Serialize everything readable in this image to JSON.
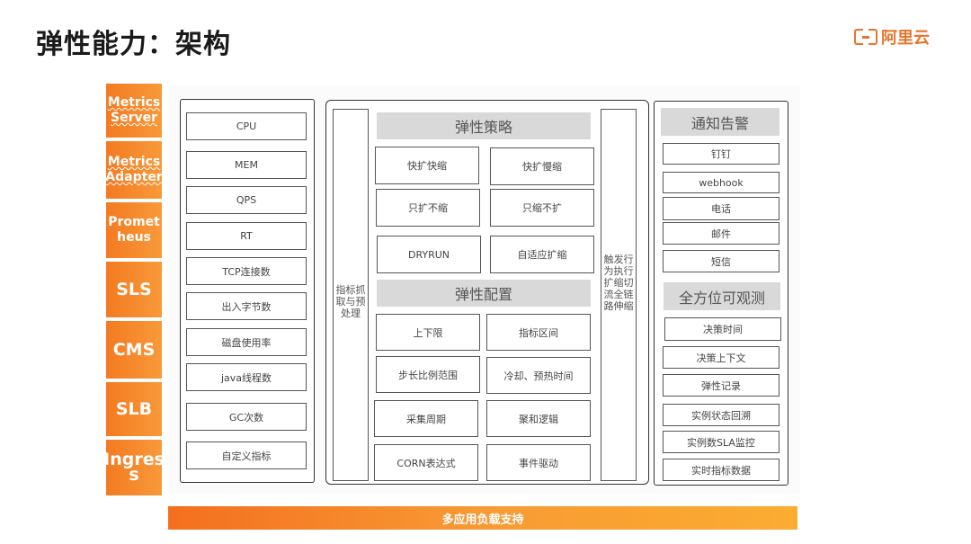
{
  "header": {
    "title": "弹性能力：架构",
    "logo_text": "阿里云",
    "brand_color": "#e8742c"
  },
  "sources": [
    {
      "label": "Metrics Server"
    },
    {
      "label": "Metrics Adapter"
    },
    {
      "label": "Promet heus"
    },
    {
      "label": "SLS"
    },
    {
      "label": "CMS"
    },
    {
      "label": "SLB"
    },
    {
      "label": "Ingres s"
    }
  ],
  "metrics": [
    "CPU",
    "MEM",
    "QPS",
    "RT",
    "TCP连接数",
    "出入字节数",
    "磁盘使用率",
    "java线程数",
    "GC次数",
    "自定义指标"
  ],
  "core": {
    "left_bar": "指标抓取与预处理",
    "right_bar": "触发行为执行扩缩切流全链路伸缩",
    "strategy": {
      "title": "弹性策略",
      "cells": [
        "快扩快缩",
        "快扩慢缩",
        "只扩不缩",
        "只缩不扩",
        "DRYRUN",
        "自适应扩缩"
      ]
    },
    "config": {
      "title": "弹性配置",
      "cells": [
        "上下限",
        "指标区间",
        "步长比例范围",
        "冷却、预热时间",
        "采集周期",
        "聚和逻辑",
        "CORN表达式",
        "事件驱动"
      ]
    }
  },
  "notify": {
    "title": "通知告警",
    "items": [
      "钉钉",
      "webhook",
      "电话",
      "邮件",
      "短信"
    ]
  },
  "observe": {
    "title": "全方位可观测",
    "items": [
      "决策时间",
      "决策上下文",
      "弹性记录",
      "实例状态回溯",
      "实例数SLA监控",
      "实时指标数据"
    ]
  },
  "footer": {
    "label": "多应用负载支持"
  }
}
